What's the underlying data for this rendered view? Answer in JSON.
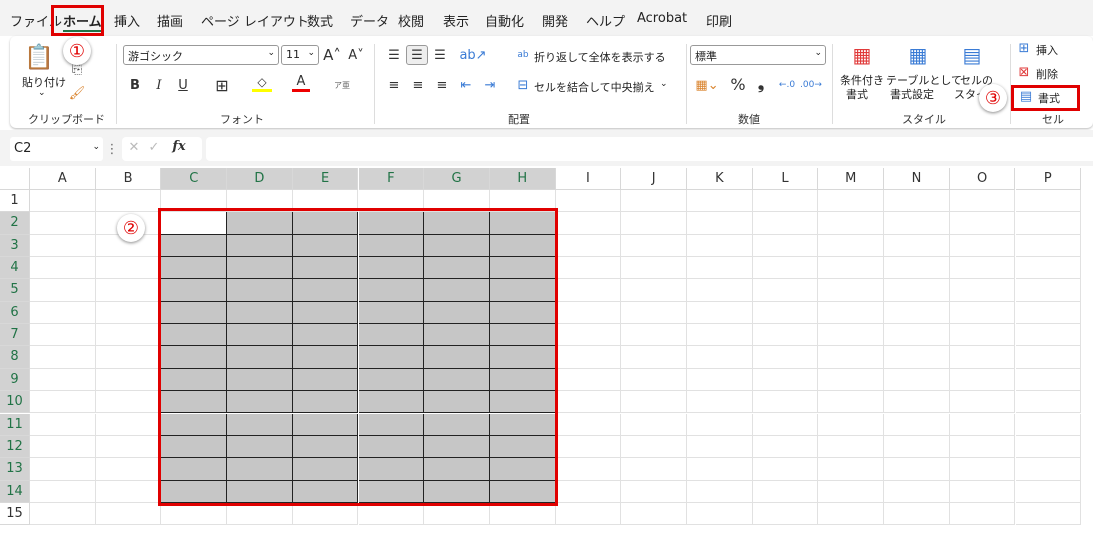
{
  "menu_tabs": [
    "ファイル",
    "ホーム",
    "挿入",
    "描画",
    "ページ レイアウト",
    "数式",
    "データ",
    "校閲",
    "表示",
    "自動化",
    "開発",
    "ヘルプ",
    "Acrobat",
    "印刷"
  ],
  "active_tab": "ホーム",
  "clipboard": {
    "paste": "貼り付け",
    "group": "クリップボード"
  },
  "font": {
    "name": "游ゴシック",
    "size": "11",
    "group": "フォント",
    "bold": "B",
    "italic": "I",
    "underline": "U",
    "color_text": "A",
    "phonetic": "ア亜",
    "fill_color": "#ffff00",
    "font_color": "#ff0000"
  },
  "alignment": {
    "wrap": "折り返して全体を表示する",
    "merge": "セルを結合して中央揃え",
    "group": "配置"
  },
  "number": {
    "format": "標準",
    "percent": "%",
    "comma": "❟",
    "group": "数値"
  },
  "styles": {
    "conditional": [
      "条件付き",
      "書式"
    ],
    "table": [
      "テーブルとして",
      "書式設定"
    ],
    "cell_styles": [
      "セルの",
      "スタイル"
    ],
    "group": "スタイル"
  },
  "cells": {
    "insert": "挿入",
    "delete": "削除",
    "format": "書式",
    "group": "セル"
  },
  "formula_bar": {
    "name_box": "C2",
    "fx": "fx",
    "value": ""
  },
  "columns": [
    "A",
    "B",
    "C",
    "D",
    "E",
    "F",
    "G",
    "H",
    "I",
    "J",
    "K",
    "L",
    "M",
    "N",
    "O",
    "P"
  ],
  "rows": [
    "1",
    "2",
    "3",
    "4",
    "5",
    "6",
    "7",
    "8",
    "9",
    "10",
    "11",
    "12",
    "13",
    "14",
    "15"
  ],
  "selection": {
    "range": "C2:H14",
    "active_cell": "C2",
    "fill_color": "#c6c6c6"
  },
  "annotations": {
    "step1": "①",
    "step2": "②",
    "step3": "③",
    "highlight_color": "#e00000"
  }
}
